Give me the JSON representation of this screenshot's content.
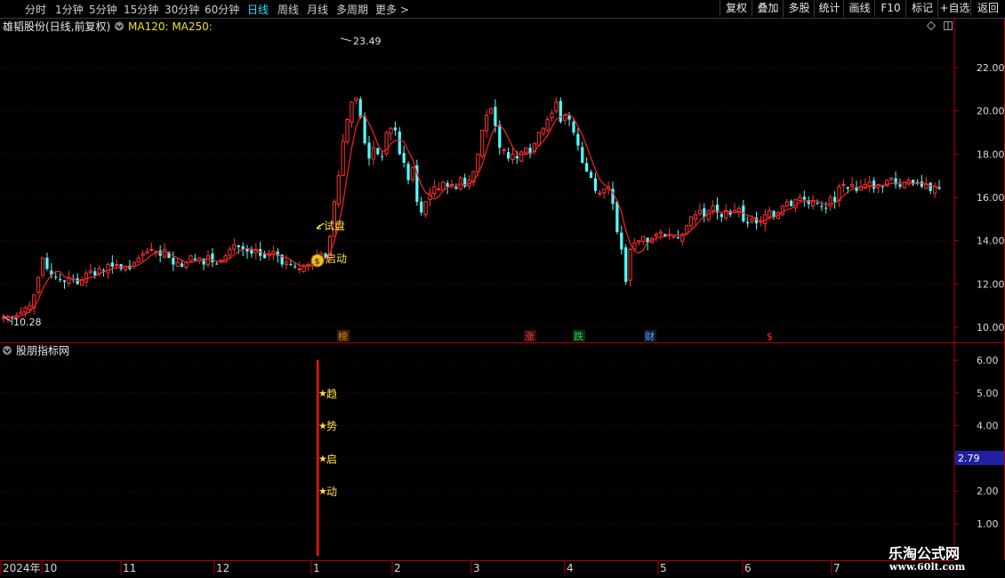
{
  "toolbar": {
    "periods": [
      {
        "label": "分时"
      },
      {
        "label": "1分钟"
      },
      {
        "label": "5分钟"
      },
      {
        "label": "15分钟"
      },
      {
        "label": "30分钟"
      },
      {
        "label": "60分钟"
      },
      {
        "label": "日线",
        "active": true
      },
      {
        "label": "周线"
      },
      {
        "label": "月线"
      },
      {
        "label": "多周期"
      },
      {
        "label": "更多 >"
      }
    ],
    "buttons": [
      {
        "label": "复权"
      },
      {
        "label": "叠加"
      },
      {
        "label": "多股"
      },
      {
        "label": "统计"
      },
      {
        "label": "画线"
      },
      {
        "label": "F10"
      },
      {
        "label": "标记"
      },
      {
        "label": "+自选"
      },
      {
        "label": "返回"
      }
    ]
  },
  "main_panel": {
    "stock_title": "雄韬股份(日线,前复权)",
    "indicator_label": "MA120: MA250:",
    "max_price_label": "23.49",
    "min_price_label": "10.28",
    "signal_trial": "试盘",
    "signal_start": "启动",
    "event_badges": [
      {
        "label": "榜",
        "color": "#d87a2a"
      },
      {
        "label": "涨",
        "color": "#e04040"
      },
      {
        "label": "跌",
        "color": "#33c24a"
      },
      {
        "label": "财",
        "color": "#6a9fe0"
      },
      {
        "label": "$",
        "color": "#ff3030"
      }
    ]
  },
  "sub_panel": {
    "title": "股朋指标网",
    "current_value": "2.79",
    "markers": [
      "趋",
      "势",
      "启",
      "动"
    ]
  },
  "x_axis": {
    "labels": [
      "2024年",
      "10",
      "11",
      "12",
      "1",
      "2",
      "3",
      "4",
      "5",
      "6",
      "7"
    ]
  },
  "watermark": {
    "line1": "乐淘公式网",
    "line2": "www.60lt.com"
  },
  "chart_data": {
    "type": "candlestick",
    "series_name": "雄韬股份",
    "price_axis": {
      "ticks": [
        10.0,
        12.0,
        14.0,
        16.0,
        18.0,
        20.0,
        22.0
      ],
      "range": [
        9.5,
        24.3
      ]
    },
    "indicator_axis": {
      "ticks": [
        1.0,
        2.0,
        3.0,
        4.0,
        5.0,
        6.0
      ],
      "range": [
        0.0,
        6.4
      ]
    },
    "close": [
      10.45,
      10.5,
      10.4,
      10.55,
      10.7,
      10.9,
      11.0,
      11.5,
      12.3,
      13.2,
      12.7,
      12.4,
      12.3,
      12.2,
      12.1,
      12.3,
      12.2,
      12.0,
      12.2,
      12.5,
      12.6,
      12.4,
      12.7,
      12.6,
      12.9,
      12.8,
      12.9,
      12.7,
      12.8,
      12.7,
      13.0,
      13.2,
      13.4,
      13.5,
      13.6,
      13.5,
      13.3,
      13.6,
      13.2,
      12.9,
      13.0,
      12.8,
      13.0,
      13.3,
      13.1,
      13.2,
      12.9,
      13.3,
      13.0,
      12.9,
      13.1,
      13.3,
      13.6,
      13.8,
      13.7,
      13.6,
      13.5,
      13.4,
      13.6,
      13.3,
      13.2,
      13.4,
      13.5,
      13.3,
      12.9,
      13.0,
      12.9,
      12.8,
      12.7,
      12.8,
      12.9,
      13.0,
      13.3,
      13.4,
      13.2,
      14.2,
      15.8,
      17.0,
      18.6,
      19.6,
      20.4,
      20.6,
      19.7,
      18.5,
      17.8,
      18.3,
      18.0,
      17.9,
      19.0,
      19.2,
      19.1,
      18.0,
      17.6,
      16.8,
      17.4,
      15.8,
      15.3,
      15.8,
      16.2,
      16.5,
      16.4,
      16.7,
      16.5,
      16.6,
      16.4,
      16.9,
      16.5,
      16.8,
      17.2,
      18.0,
      19.1,
      19.8,
      20.1,
      19.3,
      18.3,
      18.2,
      17.8,
      18.0,
      17.8,
      18.1,
      18.3,
      18.0,
      18.5,
      19.0,
      19.2,
      19.6,
      19.9,
      20.4,
      19.5,
      19.8,
      19.6,
      19.0,
      18.4,
      17.6,
      17.2,
      16.9,
      16.3,
      16.2,
      16.4,
      16.5,
      15.7,
      14.4,
      13.6,
      12.1,
      13.6,
      13.9,
      14.0,
      14.2,
      13.9,
      14.1,
      14.3,
      14.4,
      14.2,
      14.3,
      14.2,
      14.1,
      14.3,
      14.7,
      15.1,
      15.2,
      15.4,
      15.1,
      15.4,
      15.6,
      15.3,
      15.1,
      15.4,
      15.2,
      15.4,
      15.5,
      14.9,
      14.8,
      15.0,
      14.8,
      14.9,
      15.2,
      15.4,
      15.1,
      15.3,
      15.6,
      15.8,
      15.6,
      15.9,
      16.0,
      15.9,
      15.7,
      15.8,
      15.7,
      15.6,
      15.5,
      16.0,
      15.8,
      16.5,
      16.6,
      16.4,
      16.6,
      16.3,
      16.5,
      16.6,
      16.7,
      16.4,
      16.6,
      16.5,
      16.8,
      16.9,
      16.6,
      16.5,
      16.7,
      16.8,
      16.6,
      16.7,
      16.5,
      16.6,
      16.3,
      16.5,
      16.4
    ]
  }
}
